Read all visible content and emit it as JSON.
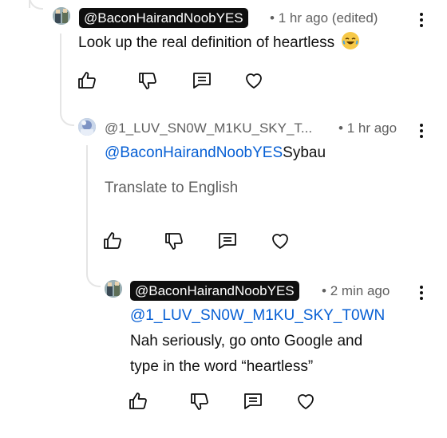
{
  "comments": [
    {
      "author": "@BaconHairandNoobYES",
      "time": "1 hr ago (edited)",
      "text": "Look up the real definition of heartless",
      "emoji": "😂"
    },
    {
      "author": "@1_LUV_SN0W_M1KU_SKY_T...",
      "time": "1 hr ago",
      "mention": "@BaconHairandNoobYES",
      "text": "Sybau",
      "translate_label": "Translate to English"
    },
    {
      "author": "@BaconHairandNoobYES",
      "time": "2 min ago",
      "mention": "@1_LUV_SN0W_M1KU_SKY_T0WN",
      "text_line1": "Nah seriously, go onto Google and",
      "text_line2": "type in the word “heartless”"
    }
  ],
  "separator": "•",
  "icons": [
    "thumbs-up-icon",
    "thumbs-down-icon",
    "reply-icon",
    "heart-icon",
    "more-vert-icon"
  ]
}
